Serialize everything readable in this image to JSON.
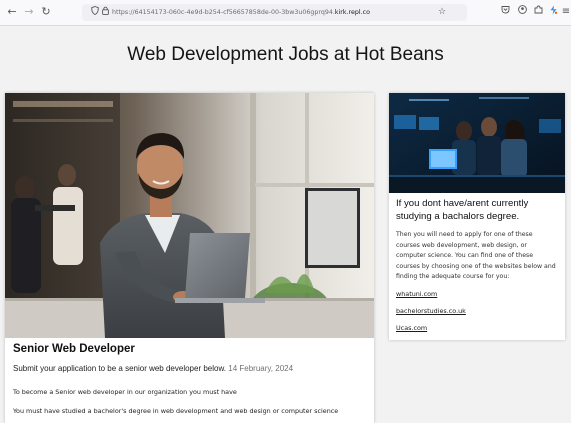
{
  "browser": {
    "url_prefix": "https://64154173-060c-4e9d-b254-cf56657858de-00-3bw3u06gprq94.",
    "url_domain": "kirk.repl.co",
    "icons": {
      "back": "back-arrow-icon",
      "forward": "forward-arrow-icon",
      "reload": "reload-icon",
      "shield": "shield-icon",
      "lock": "lock-icon",
      "bookmark": "star-icon",
      "pocket": "pocket-icon",
      "account": "account-icon",
      "extensions": "puzzle-icon",
      "replit": "replit-icon",
      "menu": "hamburger-menu-icon"
    }
  },
  "page": {
    "title": "Web Development Jobs at Hot Beans"
  },
  "job": {
    "title": "Senior Web Developer",
    "subtitle": "Submit your application to be a senior web developer below.",
    "date": "14 February, 2024",
    "body_line1": "To become a Senior web developer in our organization you must have",
    "body_line2": "You must have studied a bachelor's degree in web development and web design or computer science"
  },
  "sidebar": {
    "heading": "If you dont have/arent currently studying a bachalors degree.",
    "paragraph": "Then you will need to apply for one of these courses web development, web design, or computer science. You can find one of these courses by choosing one of the websites below and finding the adequate course for you:",
    "links": [
      "whatuni.com",
      "bachelorstudies.co.uk",
      "Ucas.com"
    ]
  },
  "colors": {
    "page_bg": "#f2f2f2",
    "card_bg": "#ffffff",
    "date_gray": "#707070",
    "replit_orange": "#f26207"
  }
}
